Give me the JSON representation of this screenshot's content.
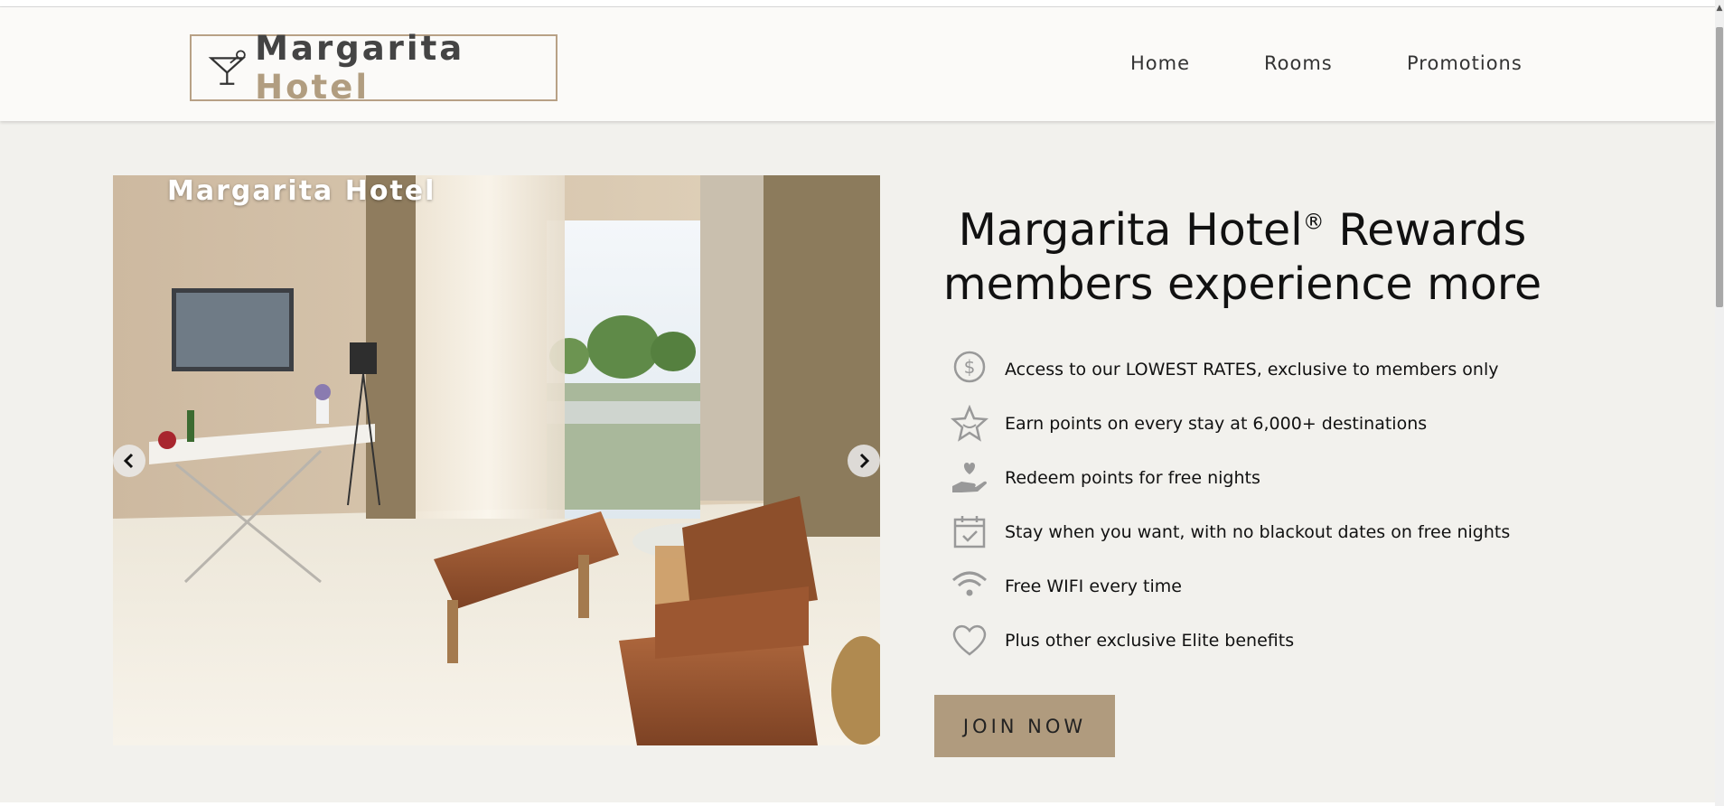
{
  "header": {
    "logo": {
      "brand_main": "Margarita",
      "brand_accent": "Hotel",
      "icon": "cocktail-glass-icon"
    },
    "nav": [
      {
        "label": "Home"
      },
      {
        "label": "Rooms"
      },
      {
        "label": "Promotions"
      }
    ]
  },
  "carousel": {
    "caption": "Margarita Hotel",
    "prev_icon": "chevron-left-icon",
    "next_icon": "chevron-right-icon"
  },
  "rewards": {
    "headline_part1": "Margarita Hotel",
    "registered_mark": "®",
    "headline_part2": " Rewards",
    "headline_line2": "members experience more",
    "benefits": [
      {
        "icon": "dollar-coin-icon",
        "text": "Access to our LOWEST RATES, exclusive to members only"
      },
      {
        "icon": "star-badge-icon",
        "text": "Earn points on every stay at 6,000+ destinations"
      },
      {
        "icon": "heart-hand-icon",
        "text": "Redeem points for free nights"
      },
      {
        "icon": "calendar-check-icon",
        "text": "Stay when you want, with no blackout dates on free nights"
      },
      {
        "icon": "wifi-icon",
        "text": "Free WIFI every time"
      },
      {
        "icon": "heart-outline-icon",
        "text": "Plus other exclusive Elite benefits"
      }
    ],
    "join_label": "JOIN NOW"
  },
  "colors": {
    "accent": "#b09b7e",
    "page_background": "#f2f1ed",
    "header_background": "#fbfaf8"
  }
}
